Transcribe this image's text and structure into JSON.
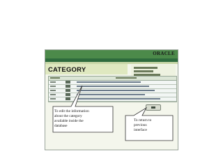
{
  "app": {
    "brand": "ORACLE",
    "page_title": "CATEGORY"
  },
  "callouts": {
    "left": [
      "To edit the information",
      "about the category",
      "available inside the",
      "database"
    ],
    "right": [
      "To return to",
      "previous",
      "interface"
    ]
  }
}
